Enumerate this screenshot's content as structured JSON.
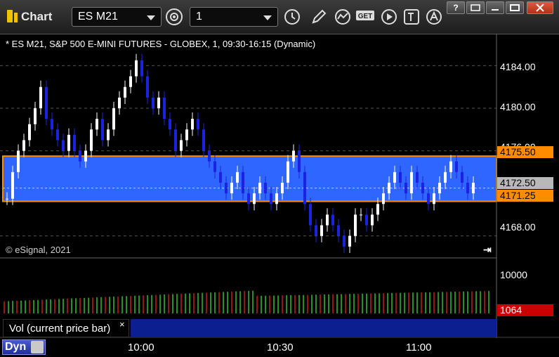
{
  "window": {
    "title": "Chart",
    "symbol_value": "ES M21",
    "interval_value": "1",
    "controls": [
      "?",
      "restore",
      "maximize",
      "close"
    ]
  },
  "toolbar_icons": [
    "settings-icon",
    "clock-icon",
    "draw-pencil-icon",
    "studies-icon",
    "get-data-icon",
    "play-icon",
    "text-tool-icon",
    "alert-icon"
  ],
  "chart": {
    "header": "* ES M21, S&P 500 E-MINI FUTURES - GLOBEX, 1, 09:30-16:15 (Dynamic)",
    "copyright": "© eSignal, 2021",
    "price_ticks": [
      "4184.00",
      "4180.00",
      "4176.00",
      "4168.00"
    ],
    "tags": {
      "upper": "4175.50",
      "current": "4172.50",
      "lower": "4171.25"
    },
    "volume_ticks": [
      "10000"
    ],
    "volume_tag": "1064",
    "time_labels": [
      "10:00",
      "10:30",
      "11:00"
    ],
    "colors": {
      "band_fill": "#2f66ff",
      "band_border": "#ff8c00",
      "up_candle": "#ffffff",
      "down_candle": "#1a24e0",
      "volume_up": "#30c030",
      "volume_down": "#c02020",
      "volume_tag": "#cc0000",
      "current_tag": "#b8b8b8"
    }
  },
  "chart_data": {
    "type": "candlestick",
    "symbol": "ES M21",
    "ylim": [
      4166,
      4187
    ],
    "y_ticks": [
      4184,
      4180,
      4176,
      4168
    ],
    "band": {
      "top": 4175.5,
      "bottom": 4171.25
    },
    "current_price": 4172.5,
    "x_ticks": [
      "10:00",
      "10:30",
      "11:00"
    ],
    "volume_ylim": [
      0,
      11000
    ],
    "volume_tick": 10000,
    "current_volume": 1064
  },
  "volume_panel": {
    "label": "Vol (current price bar)",
    "close": "×"
  },
  "bottom": {
    "dyn_label": "Dyn"
  }
}
